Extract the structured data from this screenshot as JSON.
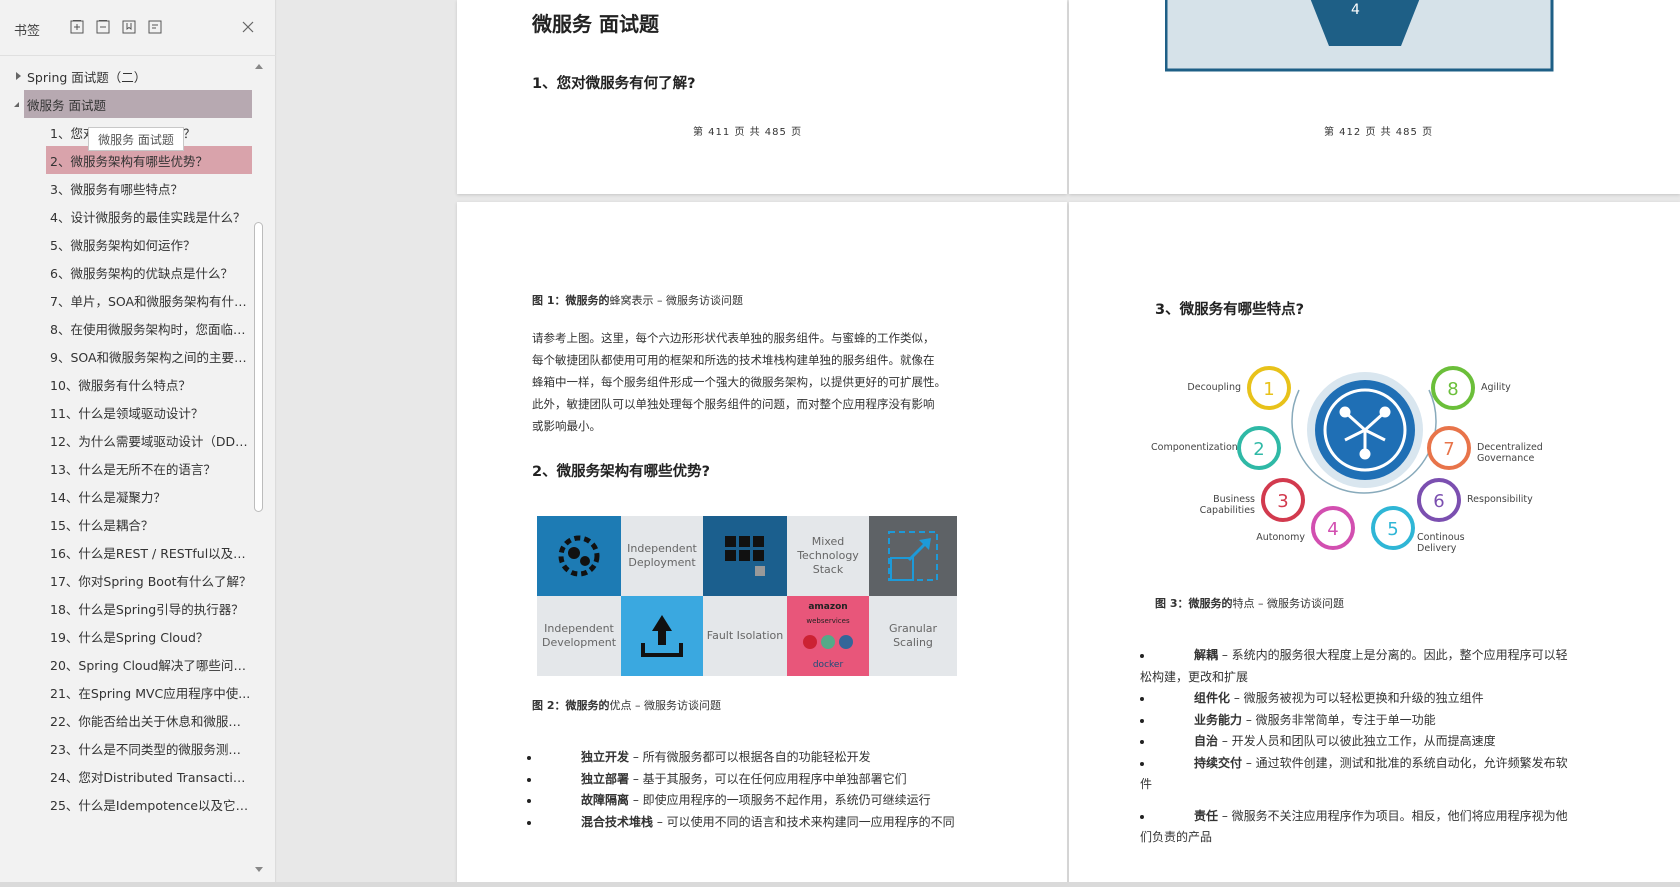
{
  "sidebar": {
    "title": "书签",
    "tools": [
      "expand-all-icon",
      "collapse-all-icon",
      "add-bookmark-icon",
      "bookmark-settings-icon"
    ],
    "tooltip": "微服务 面试题",
    "items": [
      {
        "label": "Spring 面试题（二）",
        "level": 0,
        "state": "collapsed"
      },
      {
        "label": "微服务 面试题",
        "level": 0,
        "state": "expanded",
        "selected": true
      },
      {
        "label": "1、您对微服务有何了解？",
        "level": 1
      },
      {
        "label": "2、微服务架构有哪些优势？",
        "level": 1,
        "highlighted": true
      },
      {
        "label": "3、微服务有哪些特点？",
        "level": 1
      },
      {
        "label": "4、设计微服务的最佳实践是什么？",
        "level": 1
      },
      {
        "label": "5、微服务架构如何运作？",
        "level": 1
      },
      {
        "label": "6、微服务架构的优缺点是什么？",
        "level": 1
      },
      {
        "label": "7、单片，SOA和微服务架构有什么...",
        "level": 1
      },
      {
        "label": "8、在使用微服务架构时，您面临哪...",
        "level": 1
      },
      {
        "label": "9、SOA和微服务架构之间的主要区...",
        "level": 1
      },
      {
        "label": "10、微服务有什么特点？",
        "level": 1
      },
      {
        "label": "11、什么是领域驱动设计？",
        "level": 1
      },
      {
        "label": "12、为什么需要域驱动设计（DDD...",
        "level": 1
      },
      {
        "label": "13、什么是无所不在的语言？",
        "level": 1
      },
      {
        "label": "14、什么是凝聚力？",
        "level": 1
      },
      {
        "label": "15、什么是耦合？",
        "level": 1
      },
      {
        "label": "16、什么是REST / RESTful以及它...",
        "level": 1
      },
      {
        "label": "17、你对Spring Boot有什么了解？",
        "level": 1
      },
      {
        "label": "18、什么是Spring引导的执行器？",
        "level": 1
      },
      {
        "label": "19、什么是Spring Cloud？",
        "level": 1
      },
      {
        "label": "20、Spring Cloud解决了哪些问题？",
        "level": 1
      },
      {
        "label": "21、在Spring MVC应用程序中使...",
        "level": 1
      },
      {
        "label": "22、你能否给出关于休息和微服务...",
        "level": 1
      },
      {
        "label": "23、什么是不同类型的微服务测试？",
        "level": 1
      },
      {
        "label": "24、您对Distributed Transaction...",
        "level": 1
      },
      {
        "label": "25、什么是Idempotence以及它在...",
        "level": 1
      }
    ]
  },
  "pages": {
    "p411": {
      "title": "微服务 面试题",
      "heading": "1、您对微服务有何了解?",
      "page_num": "第 411 页 共 485 页"
    },
    "p412": {
      "hex_label": "4",
      "page_num": "第 412 页 共 485 页"
    },
    "p413": {
      "fig1_caption_bold": "图 1：微服务的",
      "fig1_caption_rest": "蜂窝表示 – 微服务访谈问题",
      "para": [
        "请参考上图。这里，每个六边形形状代表单独的服务组件。与蜜蜂的工作类似，",
        "每个敏捷团队都使用可用的框架和所选的技术堆栈构建单独的服务组件。就像在",
        "蜂箱中一样，每个服务组件形成一个强大的微服务架构，以提供更好的可扩展性。",
        "此外，敏捷团队可以单独处理每个服务组件的问题，而对整个应用程序没有影响",
        "或影响最小。"
      ],
      "heading": "2、微服务架构有哪些优势?",
      "tiles": [
        "Independent Deployment",
        "Mixed Technology Stack",
        "Independent Development",
        "Fault Isolation",
        "Granular Scaling"
      ],
      "tech_logos": [
        "amazon",
        "webservices",
        "docker"
      ],
      "fig2_caption_bold": "图 2：微服务的",
      "fig2_caption_rest": "优点 – 微服务访谈问题",
      "bullets": [
        {
          "term": "独立开发",
          "desc": " – 所有微服务都可以根据各自的功能轻松开发"
        },
        {
          "term": "独立部署",
          "desc": " – 基于其服务，可以在任何应用程序中单独部署它们"
        },
        {
          "term": "故障隔离",
          "desc": " – 即使应用程序的一项服务不起作用，系统仍可继续运行"
        },
        {
          "term": "混合技术堆栈",
          "desc": " – 可以使用不同的语言和技术来构建同一应用程序的不同"
        }
      ]
    },
    "p414": {
      "heading": "3、微服务有哪些特点?",
      "features": [
        {
          "n": "1",
          "label": "Decoupling",
          "color": "#e8c21a"
        },
        {
          "n": "2",
          "label": "Componentization",
          "color": "#2fb9a6"
        },
        {
          "n": "3",
          "label": "Business Capabilities",
          "color": "#d23a4e"
        },
        {
          "n": "4",
          "label": "Autonomy",
          "color": "#d24fb0"
        },
        {
          "n": "5",
          "label": "Continous Delivery",
          "color": "#2fb6d6"
        },
        {
          "n": "6",
          "label": "Responsibility",
          "color": "#7b4fb0"
        },
        {
          "n": "7",
          "label": "Decentralized Governance",
          "color": "#e8744a"
        },
        {
          "n": "8",
          "label": "Agility",
          "color": "#6bbf3a"
        }
      ],
      "fig3_caption_bold": "图 3：微服务的",
      "fig3_caption_rest": "特点 – 微服务访谈问题",
      "bullets": [
        {
          "term": "解耦",
          "desc": " – 系统内的服务很大程度上是分离的。因此，整个应用程序可以轻",
          "cont": "松构建，更改和扩展"
        },
        {
          "term": "组件化",
          "desc": " – 微服务被视为可以轻松更换和升级的独立组件"
        },
        {
          "term": "业务能力",
          "desc": " – 微服务非常简单，专注于单一功能"
        },
        {
          "term": "自治",
          "desc": " – 开发人员和团队可以彼此独立工作，从而提高速度"
        },
        {
          "term": "持续交付",
          "desc": " – 通过软件创建，测试和批准的系统自动化，允许频繁发布软",
          "cont": "件"
        },
        {
          "term": "责任",
          "desc": " – 微服务不关注应用程序作为项目。相反，他们将应用程序视为他",
          "cont": "们负责的产品"
        }
      ]
    }
  }
}
